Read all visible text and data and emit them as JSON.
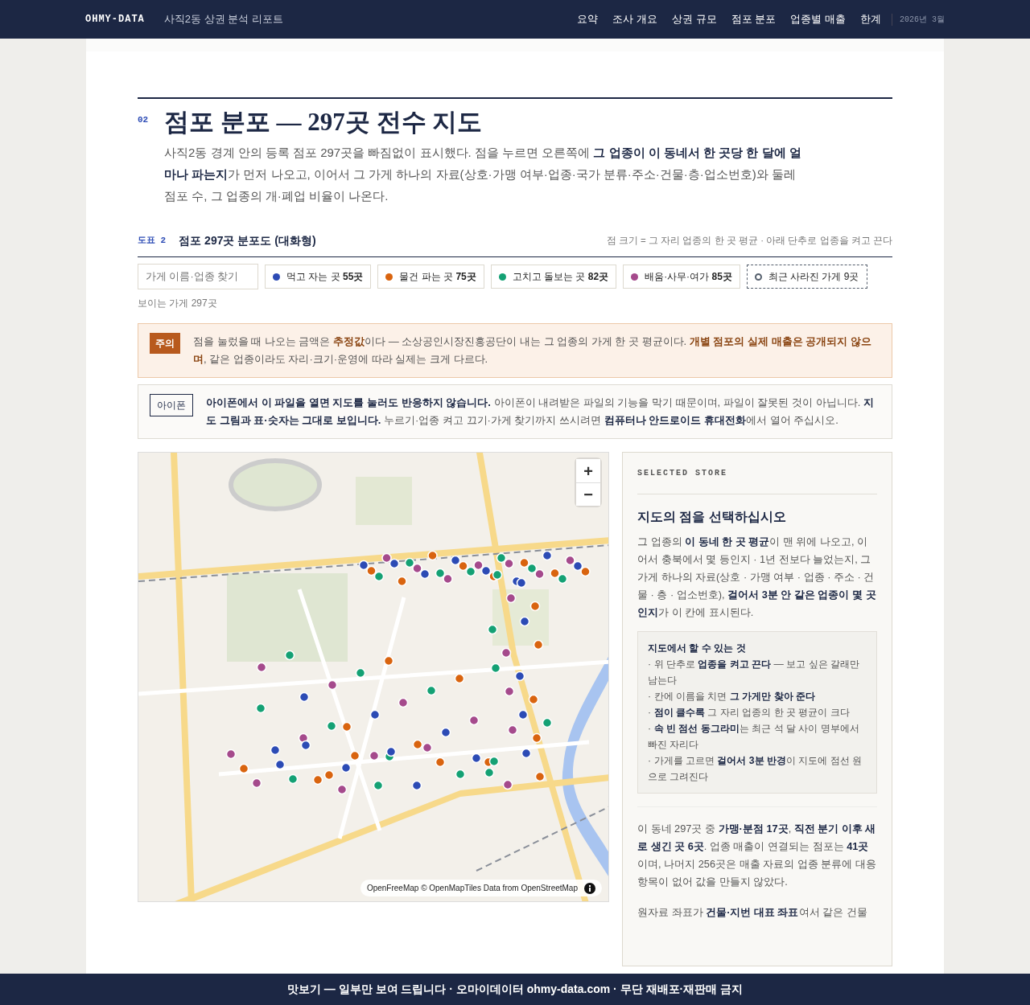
{
  "nav": {
    "brand": "OHMY-DATA",
    "subtitle": "사직2동 상권 분석 리포트",
    "links": [
      {
        "label": "요약",
        "selected": false
      },
      {
        "label": "조사 개요",
        "selected": false
      },
      {
        "label": "상권 규모",
        "selected": false
      },
      {
        "label": "점포 분포",
        "selected": false
      },
      {
        "label": "업종별 매출",
        "selected": false
      },
      {
        "label": "한계",
        "selected": false
      }
    ],
    "date": "2026년 3월"
  },
  "section": {
    "number": "02",
    "title": "점포 분포 — 297곳 전수 지도",
    "intro": "사직2동 경계 안의 등록 점포 297곳을 빠짐없이 표시했다. 점을 누르면 오른쪽에 **그 업종이 이 동네서 한 곳당 한 달에 얼마나 파는지**가 먼저 나오고, 이어서 그 가게 하나의 자료(상호·가맹 여부·업종·국가 분류·주소·건물·층·업소번호)와 둘레 점포 수, 그 업종의 개·폐업 비율이 나온다."
  },
  "figure": {
    "label": "도표 2",
    "title": "점포 297곳 분포도 (대화형)",
    "note": "점 크기 = 그 자리 업종의 한 곳 평균 · 아래 단추로 업종을 켜고 끈다"
  },
  "filters": {
    "search": {
      "placeholder": "가게 이름·업종 찾기"
    },
    "categories": [
      {
        "kind": "category",
        "label": "먹고 자는 곳 **55곳**",
        "color": "#2c4bb5",
        "on": true
      },
      {
        "kind": "category",
        "label": "물건 파는 곳 **75곳**",
        "color": "#d9640f",
        "on": true
      },
      {
        "kind": "category",
        "label": "고치고 돌보는 곳 **82곳**",
        "color": "#14a174",
        "on": true
      },
      {
        "kind": "category",
        "label": "배움·사무·여가 **85곳**",
        "color": "#a54a8c",
        "on": true
      },
      {
        "kind": "closed",
        "label": "최근 사라진 가게 9곳",
        "color": "#555f6d",
        "on": true
      }
    ],
    "visible_count": "보이는 가게 297곳"
  },
  "notices": [
    {
      "kind": "caution",
      "tag": "주의",
      "text": "점을 눌렀을 때 나오는 금액은 **추정값**이다 — 소상공인시장진흥공단이 내는 그 업종의 가게 한 곳 평균이다. **개별 점포의 실제 매출은 공개되지 않으며**, 같은 업종이라도 자리·크기·운영에 따라 실제는 크게 다르다."
    },
    {
      "kind": "info",
      "tag": "아이폰",
      "text": "**아이폰에서 이 파일을 열면 지도를 눌러도 반응하지 않습니다.** 아이폰이 내려받은 파일의 기능을 막기 때문이며, 파일이 잘못된 것이 아닙니다. **지도 그림과 표·숫자는 그대로 보입니다.** 누르기·업종 켜고 끄기·가게 찾기까지 쓰시려면 **컴퓨터나 안드로이드 휴대전화**에서 열어 주십시오."
    }
  ],
  "map": {
    "zoom_in": "+",
    "zoom_out": "−",
    "attribution": "OpenFreeMap © OpenMapTiles Data from OpenStreetMap"
  },
  "panel": {
    "eyebrow": "SELECTED STORE",
    "title": "지도의 점을 선택하십시오",
    "body": "그 업종의 **이 동네 한 곳 평균**이 맨 위에 나오고, 이어서 충북에서 몇 등인지 · 1년 전보다 늘었는지, 그 가게 하나의 자료(상호 · 가맹 여부 · 업종 · 주소 · 건물 · 층 · 업소번호), **걸어서 3분 안 같은 업종이 몇 곳인지**가 이 칸에 표시된다.",
    "tips": {
      "title": "지도에서 할 수 있는 것",
      "items": [
        "· 위 단추로 **업종을 켜고 끈다** — 보고 싶은 갈래만 남는다",
        "· 칸에 이름을 치면 **그 가게만 찾아 준다**",
        "· **점이 클수록** 그 자리 업종의 한 곳 평균이 크다",
        "· **속 빈 점선 동그라미**는 최근 석 달 사이 명부에서 빠진 자리다",
        "· 가게를 고르면 **걸어서 3분 반경**이 지도에 점선 원으로 그려진다"
      ]
    },
    "paragraphs": [
      "이 동네 297곳 중 **가맹·분점 17곳**, **직전 분기 이후 새로 생긴 곳 6곳**. 업종 매출이 연결되는 점포는 **41곳**이며, 나머지 256곳은 매출 자료의 업종 분류에 대응 항목이 없어 값을 만들지 않았다.",
      "원자료 좌표가 **건물·지번 대표 좌표**여서 같은 건물"
    ]
  },
  "banner": "맛보기 — 일부만 보여 드립니다 · 오마이데이터 ohmy-data.com · 무단 재배포·재판매 금지"
}
